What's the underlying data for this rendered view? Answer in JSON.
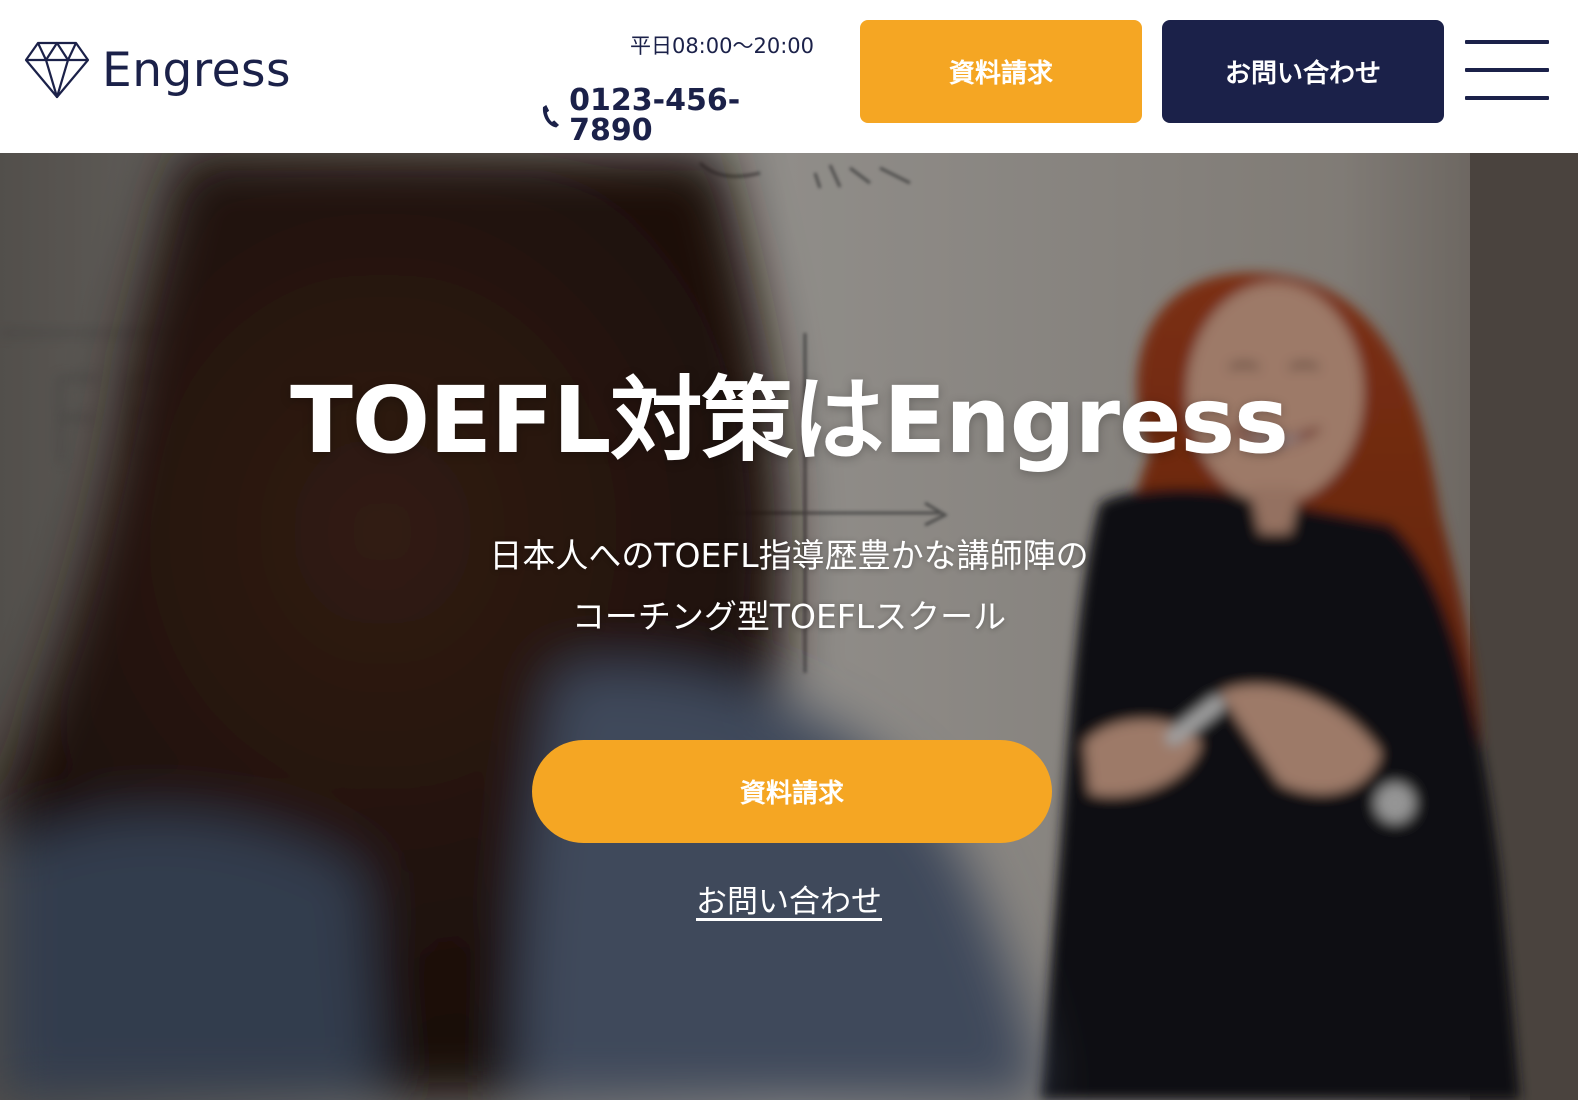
{
  "colors": {
    "accent": "#f5a623",
    "navy": "#1b2149",
    "white": "#ffffff"
  },
  "header": {
    "logo_text": "Engress",
    "logo_icon": "diamond-icon",
    "hours": "平日08:00〜20:00",
    "phone_icon": "phone-icon",
    "phone": "0123-456-7890",
    "doc_button": "資料請求",
    "contact_button": "お問い合わせ",
    "menu_icon": "hamburger-icon"
  },
  "hero": {
    "title": "TOEFL対策はEngress",
    "subtitle_line1": "日本人へのTOEFL指導歴豊かな講師陣の",
    "subtitle_line2": "コーチング型TOEFLスクール",
    "cta_button": "資料請求",
    "contact_link": "お問い合わせ",
    "background_image": "photo of a smiling teacher with long red hair holding a marker in front of a whiteboard, a student blurred in the foreground"
  }
}
